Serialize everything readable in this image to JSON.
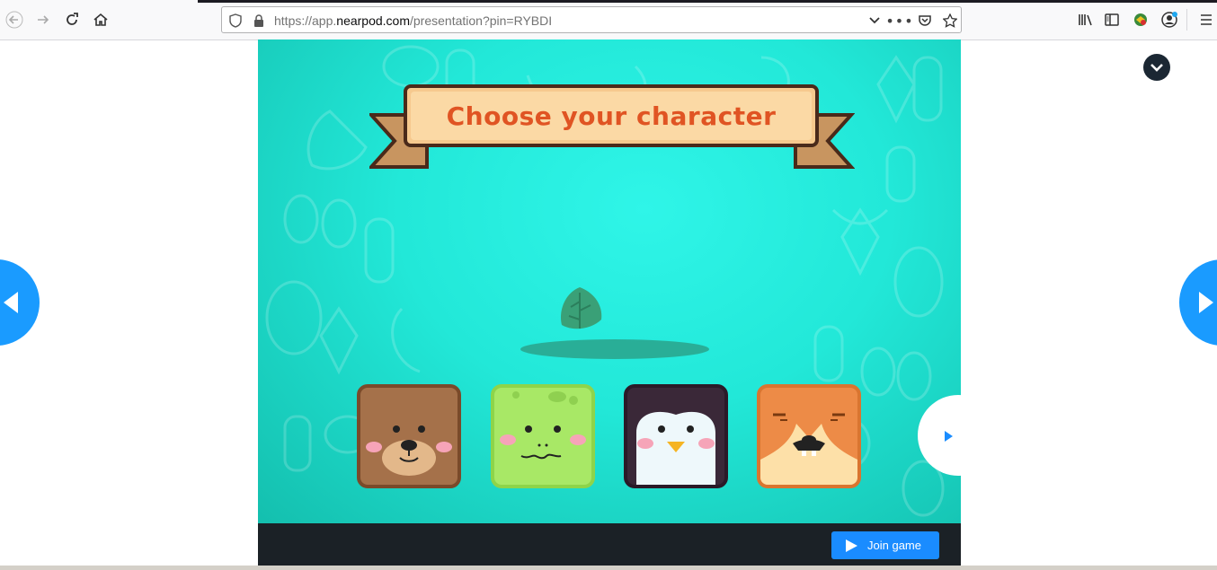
{
  "browser": {
    "url_prefix": "https://app.",
    "url_domain": "nearpod.com",
    "url_suffix": "/presentation?pin=RYBDI"
  },
  "game": {
    "title": "Choose your character",
    "characters": [
      {
        "name": "bear",
        "color": "#a5714a"
      },
      {
        "name": "frog",
        "color": "#a8e866"
      },
      {
        "name": "penguin",
        "color": "#3a2838"
      },
      {
        "name": "fox",
        "color": "#ed8b47"
      }
    ],
    "join_label": "Join game"
  },
  "colors": {
    "accent": "#1a8cff",
    "stage": "#22e8d8",
    "banner_text": "#e05423"
  }
}
